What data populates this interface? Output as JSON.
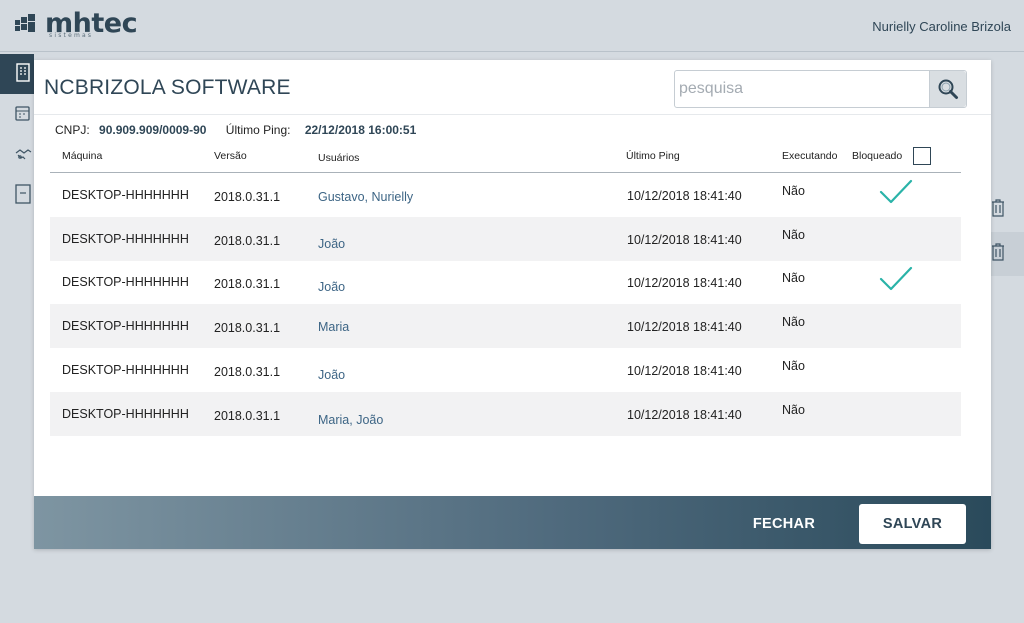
{
  "header": {
    "logo_text": "mhtec",
    "logo_sub": "sistemas",
    "user_name": "Nurielly Caroline Brizola"
  },
  "modal": {
    "title": "NCBRIZOLA SOFTWARE",
    "search": {
      "placeholder": "pesquisa",
      "value": ""
    },
    "info": {
      "cnpj_label": "CNPJ:",
      "cnpj_value": "90.909.909/0009-90",
      "ping_label": "Último Ping:",
      "ping_value": "22/12/2018 16:00:51"
    },
    "columns": {
      "machine": "Máquina",
      "version": "Versão",
      "users": "Usuários",
      "last_ping": "Último Ping",
      "running": "Executando",
      "blocked": "Bloqueado"
    },
    "rows": [
      {
        "machine": "DESKTOP-HHHHHHH",
        "version": "2018.0.31.1",
        "users": "Gustavo, Nurielly",
        "last_ping": "10/12/2018 18:41:40",
        "running": "Não",
        "blocked": true
      },
      {
        "machine": "DESKTOP-HHHHHHH",
        "version": "2018.0.31.1",
        "users": "João",
        "last_ping": "10/12/2018 18:41:40",
        "running": "Não",
        "blocked": false
      },
      {
        "machine": "DESKTOP-HHHHHHH",
        "version": "2018.0.31.1",
        "users": "João",
        "last_ping": "10/12/2018 18:41:40",
        "running": "Não",
        "blocked": true
      },
      {
        "machine": "DESKTOP-HHHHHHH",
        "version": "2018.0.31.1",
        "users": "Maria",
        "last_ping": "10/12/2018 18:41:40",
        "running": "Não",
        "blocked": false
      },
      {
        "machine": "DESKTOP-HHHHHHH",
        "version": "2018.0.31.1",
        "users": "João",
        "last_ping": "10/12/2018 18:41:40",
        "running": "Não",
        "blocked": false
      },
      {
        "machine": "DESKTOP-HHHHHHH",
        "version": "2018.0.31.1",
        "users": "Maria, João",
        "last_ping": "10/12/2018 18:41:40",
        "running": "Não",
        "blocked": false
      }
    ],
    "footer": {
      "close_label": "FECHAR",
      "save_label": "SALVAR"
    }
  },
  "colors": {
    "brand": "#2f4656",
    "check": "#2ab3a8",
    "user_link": "#3d6585"
  },
  "icons": {
    "search": "search-icon",
    "check": "check-icon",
    "nav": [
      "building-icon",
      "calendar-icon",
      "handshake-icon",
      "document-icon"
    ],
    "trash": "trash-icon"
  }
}
